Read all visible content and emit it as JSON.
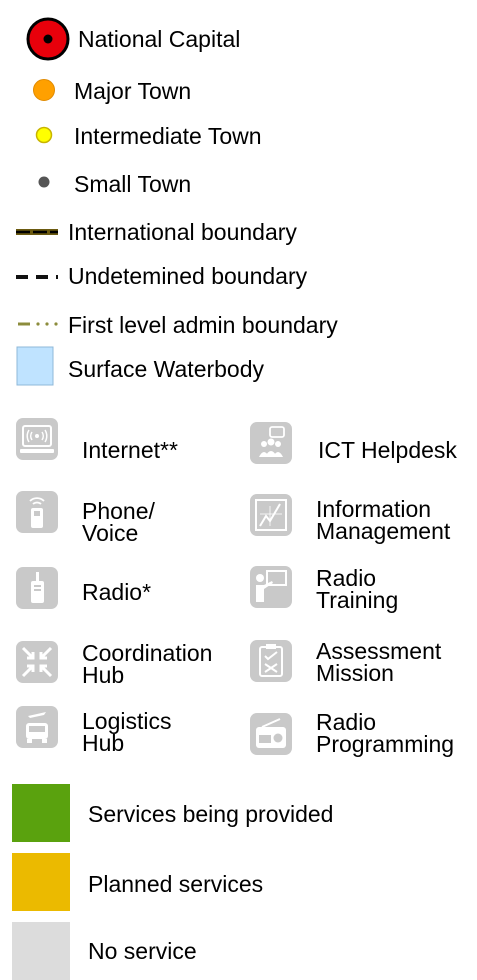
{
  "legend": {
    "places": [
      {
        "label": "National Capital"
      },
      {
        "label": "Major Town"
      },
      {
        "label": "Intermediate Town"
      },
      {
        "label": "Small Town"
      }
    ],
    "lines": [
      {
        "label": "International boundary"
      },
      {
        "label": "Undetemined boundary"
      },
      {
        "label": "First level admin boundary"
      },
      {
        "label": "Surface Waterbody"
      }
    ],
    "services": [
      {
        "label": "Internet**",
        "icon": "internet-icon"
      },
      {
        "label": "ICT Helpdesk",
        "icon": "helpdesk-icon"
      },
      {
        "label": "Phone/\nVoice",
        "icon": "phone-icon"
      },
      {
        "label": "Information\nManagement",
        "icon": "information-management-icon"
      },
      {
        "label": "Radio*",
        "icon": "radio-handset-icon"
      },
      {
        "label": "Radio\nTraining",
        "icon": "radio-training-icon"
      },
      {
        "label": "Coordination\nHub",
        "icon": "coordination-hub-icon"
      },
      {
        "label": "Assessment\nMission",
        "icon": "assessment-mission-icon"
      },
      {
        "label": "Logistics\nHub",
        "icon": "logistics-hub-icon"
      },
      {
        "label": "Radio\nProgramming",
        "icon": "radio-programming-icon"
      }
    ],
    "status": [
      {
        "label": "Services being provided",
        "color": "#5aa20e"
      },
      {
        "label": "Planned services",
        "color": "#ebba00"
      },
      {
        "label": "No service",
        "color": "#dcdcdc"
      }
    ]
  },
  "colors": {
    "national_capital": "#e8000b",
    "major_town": "#ffa000",
    "intermediate_town": "#ffff00",
    "small_town": "#555555",
    "waterbody": "#bfe3ff",
    "icon_tile": "#c9c9c9"
  }
}
